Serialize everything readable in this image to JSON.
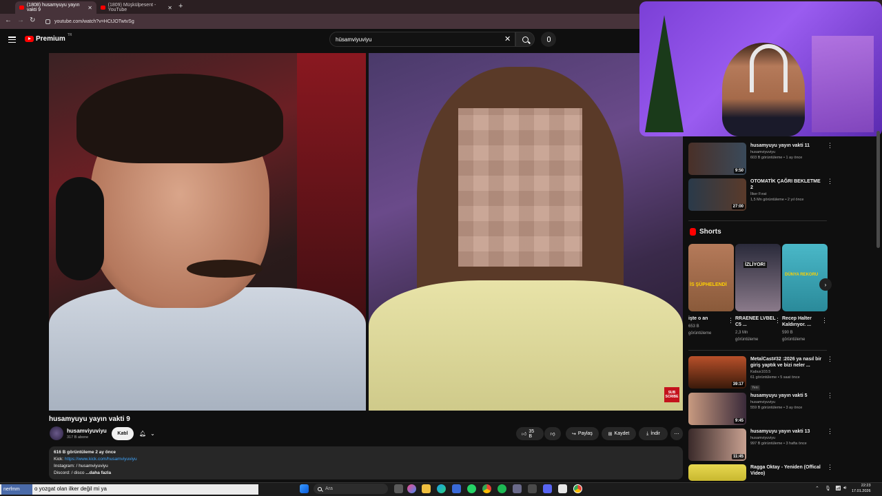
{
  "browser": {
    "tabs": [
      {
        "label": "(1808) husamyuyu yayın vakti 9",
        "active": true
      },
      {
        "label": "(1809) Müşkülpesent - YouTube",
        "active": false
      }
    ],
    "url": "youtube.com/watch?v=HCtJOTwtvSg"
  },
  "header": {
    "logo_word": "Premium",
    "logo_country": "TR",
    "search_value": "hüsamviyuviyu"
  },
  "video": {
    "title": "husamyuyu yayın vakti 9",
    "subscribe_overlay": "SUB SCRIBE",
    "channel": {
      "name": "husamviyuviyu",
      "subs": "317 B abone"
    },
    "join_label": "Katıl",
    "likes": "35 B",
    "share_label": "Paylaş",
    "save_label": "Kaydet",
    "download_label": "İndir",
    "description": {
      "stats": "616 B görüntüleme  2 ay önce",
      "kick_label": "Kick: ",
      "kick_link": "https://www.kick.com/husamviyuviyu",
      "instagram": "Instagram:  / husamviyuviyu",
      "discord": "Discord:  / disco",
      "more_label": "...daha fazla"
    }
  },
  "sidebar": {
    "recs_top": [
      {
        "title": "husamyuyu yayın vakti 11",
        "channel": "husamviyuviyu",
        "meta": "603 B görüntüleme • 1 ay önce",
        "duration": "9:50",
        "color": "#3a4a5a"
      },
      {
        "title": "OTOMATİK ÇAĞRI BEKLETME 2",
        "channel": "İlker Fırat",
        "meta": "1,5 Mn görüntüleme • 2 yıl önce",
        "duration": "27:00",
        "color": "#2a3a4a"
      }
    ],
    "shorts_title": "Shorts",
    "shorts": [
      {
        "title": "işte o an",
        "meta1": "653 B",
        "meta2": "görüntüleme",
        "overlay": "İS ŞÜPHELENDİ",
        "color": "#8a5a3a"
      },
      {
        "title": "RRAENEE LVBEL C5 ...",
        "meta1": "2,3 Mn",
        "meta2": "görüntüleme",
        "overlay": "İZLİYOR!",
        "color": "#4a4a6a"
      },
      {
        "title": "Recep Halter Kaldırıyor. ...",
        "meta1": "590 B",
        "meta2": "görüntüleme",
        "overlay": "DÜNYA REKORU",
        "color": "#3a9aa8"
      }
    ],
    "recs_bottom": [
      {
        "title": "MetalCast#32 :2026 ya nasıl bir giriş yaptık ve bizi neler ...",
        "channel": "Kabus103.5",
        "meta": "61 görüntüleme • 5 saat önce",
        "duration": "39:17",
        "badge": "Yeni",
        "color": "#6a3a1a"
      },
      {
        "title": "husamyuyu yayın vakti 5",
        "channel": "husamviyuviyu",
        "meta": "559 B görüntüleme • 3 ay önce",
        "duration": "9:45",
        "color": "#5a4a5a"
      },
      {
        "title": "husamyuyu yayın vakti 13",
        "channel": "husamviyuviyu",
        "meta": "997 B görüntüleme • 3 hafta önce",
        "duration": "11:45",
        "color": "#4a3a4a"
      },
      {
        "title": "Ragga Oktay - Yeniden (Offical Video)",
        "channel": "",
        "meta": "",
        "duration": "",
        "color": "#d8c840"
      }
    ]
  },
  "taskbar": {
    "chat_user": "nerfmm",
    "chat_message": "o yozgat olan ilker değil mi ya",
    "search_placeholder": "Ara",
    "time": "22:23",
    "date": "17.01.2026"
  },
  "colors": {
    "youtube_red": "#ff0000",
    "link_blue": "#3ea6ff",
    "webcam_purple": "#9a5cf0"
  }
}
